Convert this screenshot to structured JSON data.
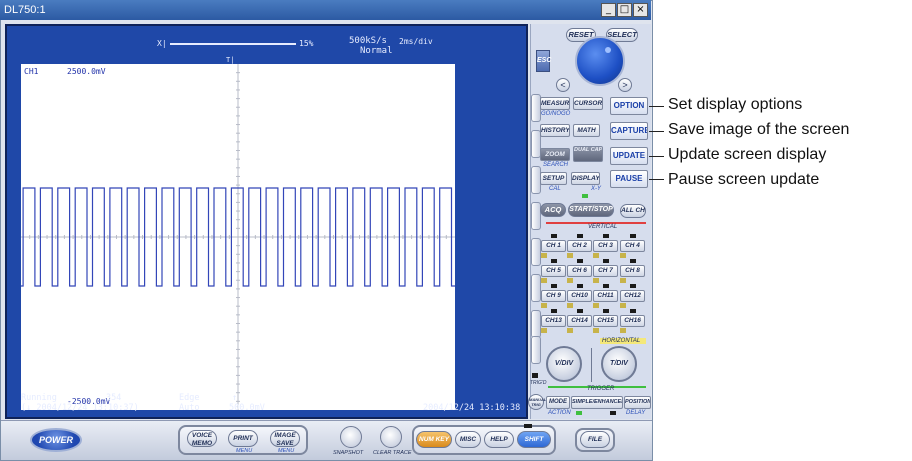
{
  "window": {
    "title": "DL750:1",
    "minimize": "_",
    "maximize": "□",
    "close": "×"
  },
  "screen": {
    "top_left": "X|",
    "top_right": "15%",
    "sample_rate": "500kS/s",
    "time_div": "2ms/div",
    "acq_mode": "Normal",
    "trigger_marker": "T|",
    "ch_label": "CH1",
    "ch_top_scale": "2500.0mV",
    "ch_bottom_scale": "-2500.0mV",
    "status": "Running",
    "count": "354",
    "trigger_type": "Edge",
    "trigger_mode": "Auto",
    "trigger_slope": "↑",
    "trigger_level": "500.0mV",
    "start_time": "(↓ 2004/12/24 13:10:37)",
    "end_time": "2004/12/24 13:10:38"
  },
  "chart_data": {
    "type": "line",
    "title": "",
    "series": [
      {
        "name": "CH1",
        "description_shape": "square wave",
        "high": 1,
        "low": -1
      }
    ],
    "cycles": 25,
    "ylim": [
      -2500,
      2500
    ],
    "yunits": "mV",
    "grid": true
  },
  "panel": {
    "reset": "RESET",
    "select": "SELECT",
    "esc": "ESC",
    "left_arrow": "<",
    "right_arrow": ">",
    "measure": "MEASURE",
    "cursor": "CURSOR",
    "gonogo": "GO/NOGO",
    "history": "HISTORY",
    "math": "MATH",
    "zoom": "ZOOM",
    "dual_capture": "DUAL CAPTURE",
    "search": "SEARCH",
    "setup": "SETUP",
    "display": "DISPLAY",
    "cal": "CAL",
    "xy": "X-Y",
    "acq": "ACQ",
    "start_stop": "START/STOP",
    "all_ch": "ALL CH",
    "vertical": "VERTICAL",
    "option": "OPTION",
    "capture": "CAPTURE",
    "update": "UPDATE",
    "pause": "PAUSE",
    "channels": [
      "CH 1",
      "CH 2",
      "CH 3",
      "CH 4",
      "CH 5",
      "CH 6",
      "CH 7",
      "CH 8",
      "CH 9",
      "CH10",
      "CH11",
      "CH12",
      "CH13",
      "CH14",
      "CH15",
      "CH16"
    ],
    "horizontal": "HORIZONTAL",
    "vdiv": "V/DIV",
    "tdiv": "T/DIV",
    "trig_d": "TRIG'D",
    "trigger": "TRIGGER",
    "manual_trig": "MANUAL TRIG",
    "mode": "MODE",
    "simple_enhanced": "SIMPLE/ENHANCED",
    "position": "POSITION",
    "action": "ACTION",
    "delay": "DELAY"
  },
  "bottom": {
    "power": "POWER",
    "voice_memo": "VOICE MEMO",
    "print": "PRINT",
    "menu1": "MENU",
    "image_save": "IMAGE SAVE",
    "menu2": "MENU",
    "snapshot": "SNAPSHOT",
    "clear_trace": "CLEAR TRACE",
    "num_key": "NUM KEY",
    "misc": "MISC",
    "help": "HELP",
    "shift": "SHIFT",
    "file": "FILE"
  },
  "callouts": {
    "option": "Set display options",
    "capture": "Save image of the screen",
    "update": "Update screen display",
    "pause": "Pause screen update"
  },
  "colors": {
    "screen_bg": "#1f48a8",
    "trace": "#3346b8",
    "accent_blue": "#1a3fa8"
  }
}
